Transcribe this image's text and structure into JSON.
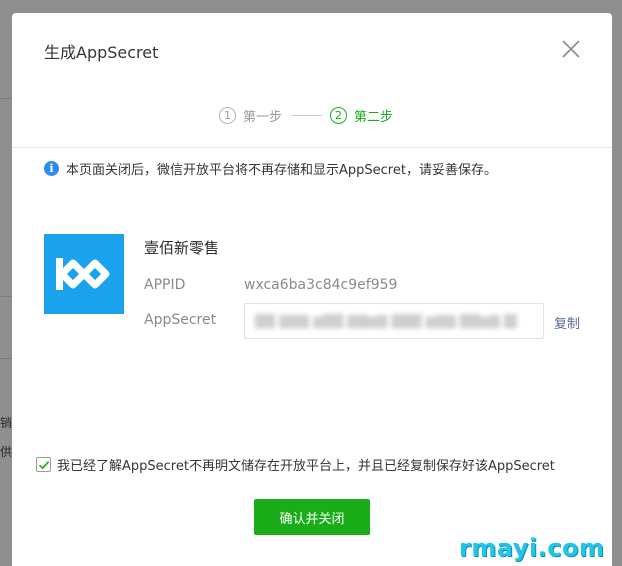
{
  "dialog": {
    "title": "生成AppSecret",
    "close_icon": "close-icon"
  },
  "steps": [
    {
      "number": "1",
      "label": "第一步",
      "state": "done"
    },
    {
      "number": "2",
      "label": "第二步",
      "state": "active"
    }
  ],
  "notice": {
    "icon": "info-icon",
    "text": "本页面关闭后，微信开放平台将不再存储和显示AppSecret，请妥善保存。"
  },
  "app": {
    "name": "壹佰新零售",
    "appid_label": "APPID",
    "appid_value": "wxca6ba3c84c9ef959",
    "secret_label": "AppSecret",
    "secret_value_masked": "",
    "copy_label": "复制"
  },
  "confirm": {
    "checked": true,
    "text": "我已经了解AppSecret不再明文储存在开放平台上，并且已经复制保存好该AppSecret",
    "button_label": "确认并关闭"
  },
  "background": {
    "fragment_1": "销",
    "fragment_2": "供"
  },
  "watermark": "rmayi.com",
  "colors": {
    "primary_green": "#1aad19",
    "info_blue": "#2d8cf0",
    "link_blue": "#576b95",
    "logo_blue": "#1aa3ec"
  }
}
